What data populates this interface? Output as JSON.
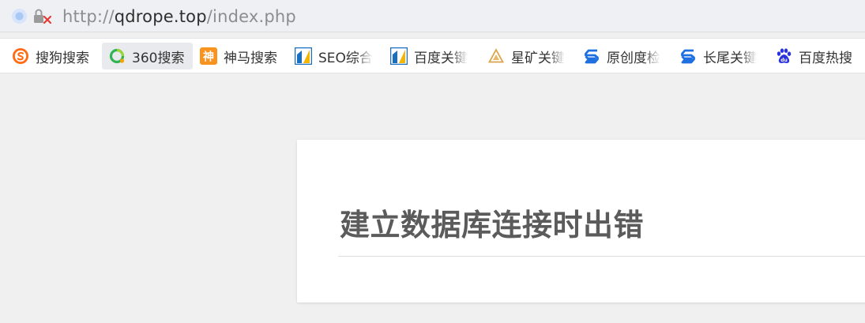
{
  "browser": {
    "url": {
      "protocol": "http://",
      "host": "qdrope.top",
      "path": "/index.php"
    }
  },
  "bookmarks": [
    {
      "label": "搜狗搜索",
      "icon": "sogou-icon"
    },
    {
      "label": "360搜索",
      "icon": "360-icon"
    },
    {
      "label": "神马搜索",
      "icon": "shenma-icon"
    },
    {
      "label": "SEO综合",
      "icon": "seo-tool-icon"
    },
    {
      "label": "百度关键",
      "icon": "seo-tool-icon"
    },
    {
      "label": "星矿关键",
      "icon": "xingkuang-icon"
    },
    {
      "label": "原创度检",
      "icon": "s-logo-icon"
    },
    {
      "label": "长尾关键",
      "icon": "s-logo-icon"
    },
    {
      "label": "百度热搜",
      "icon": "baidu-paw-icon"
    }
  ],
  "page": {
    "error_title": "建立数据库连接时出错"
  },
  "colors": {
    "background": "#f0f0f0",
    "card": "#ffffff",
    "title": "#5b5b5b"
  }
}
